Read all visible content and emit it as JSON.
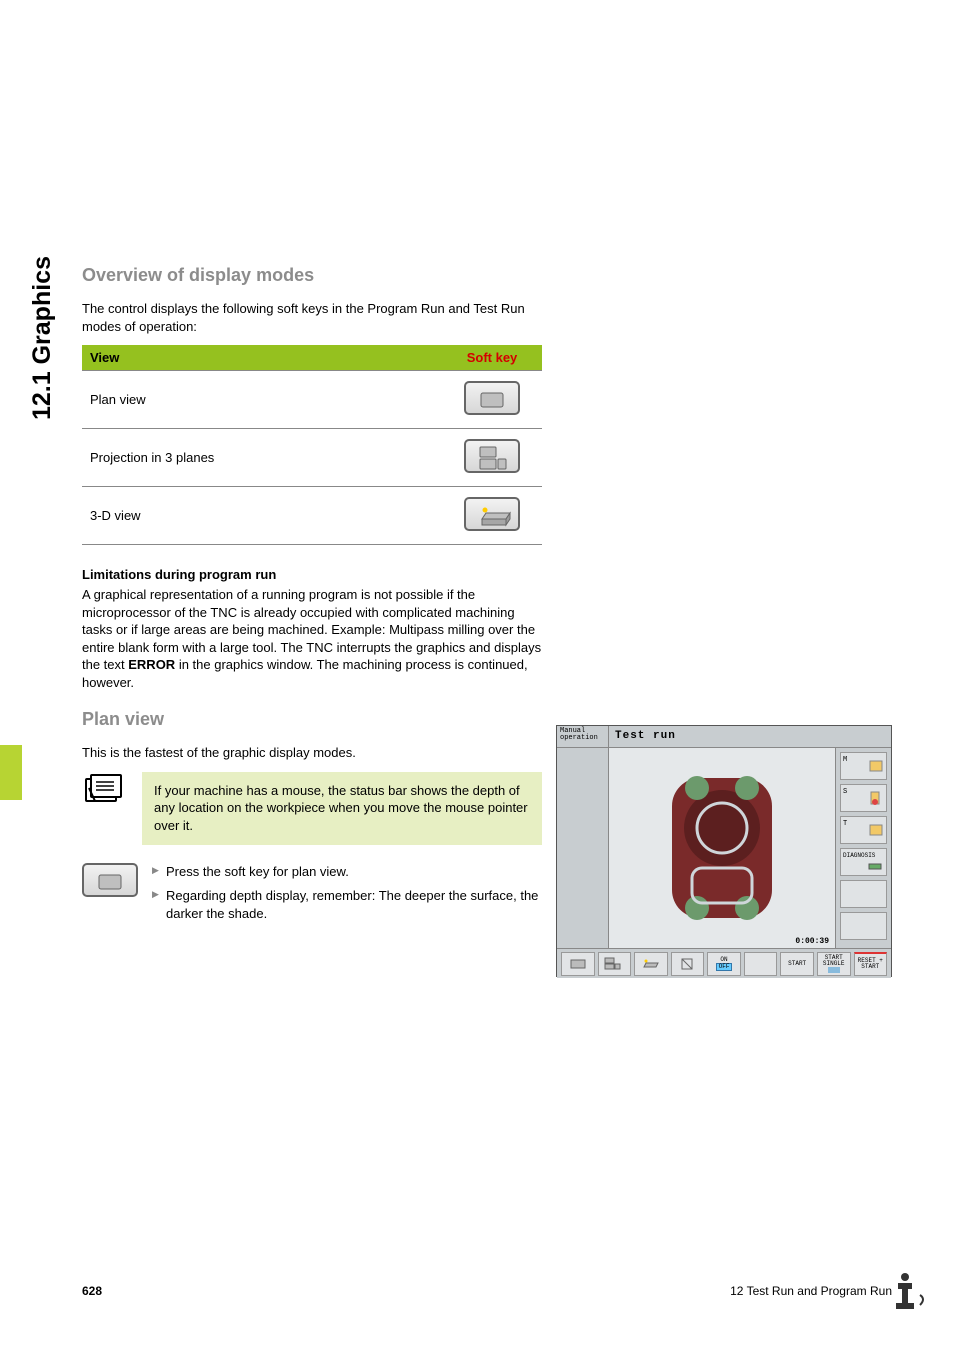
{
  "side_label": "12.1 Graphics",
  "section1_title": "Overview of display modes",
  "intro_para": "The control displays the following soft keys in the Program Run and Test Run modes of operation:",
  "table_head": {
    "view": "View",
    "softkey": "Soft key"
  },
  "table_rows": [
    {
      "label": "Plan view"
    },
    {
      "label": "Projection in 3 planes"
    },
    {
      "label": "3-D view"
    }
  ],
  "limitations_title": "Limitations during program run",
  "limitations_text_a": "A graphical representation of a running program is not possible if the microprocessor of the TNC is already occupied with complicated machining tasks or if large areas are being machined. Example: Multipass milling over the entire blank form with a large tool. The TNC interrupts the graphics and displays the text ",
  "limitations_error": "ERROR",
  "limitations_text_b": " in the graphics window. The machining process is continued, however.",
  "section2_title": "Plan view",
  "plan_intro": "This is the fastest of the graphic display modes.",
  "note_text": "If your machine has a mouse, the status bar shows the depth of any location on the workpiece when you move the mouse pointer over it.",
  "step1": "Press the soft key for plan view.",
  "step2": "Regarding depth display, remember: The deeper the surface, the darker the shade.",
  "screenshot": {
    "manual": "Manual operation",
    "title": "Test run",
    "timer": "0:00:39",
    "side": {
      "m": "M",
      "s": "S",
      "t": "T",
      "diag": "DIAGNOSIS"
    },
    "bottom": {
      "onoff_on": "ON",
      "onoff_off": "OFF",
      "start": "START",
      "start_single": "START SINGLE",
      "reset": "RESET + START"
    }
  },
  "footer": {
    "page": "628",
    "chapter": "12 Test Run and Program Run"
  }
}
